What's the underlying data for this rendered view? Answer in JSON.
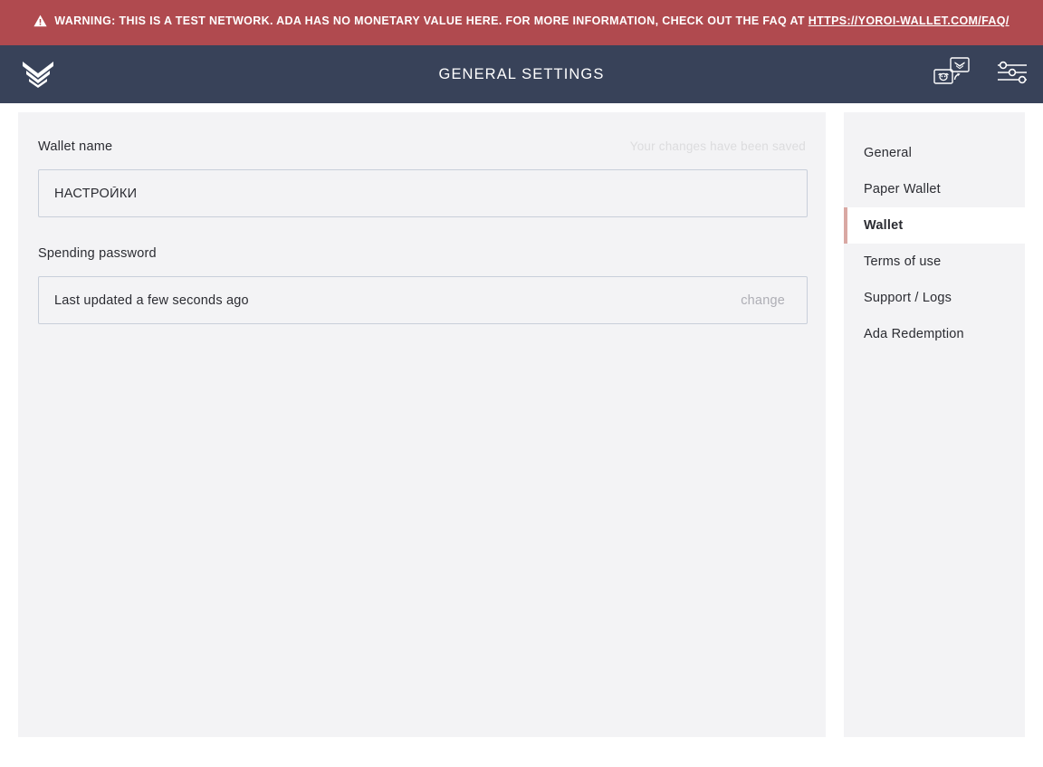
{
  "warning": {
    "icon": "warning-triangle-icon",
    "text_before_link": "WARNING: THIS IS A TEST NETWORK. ADA HAS NO MONETARY VALUE HERE. FOR MORE INFORMATION, CHECK OUT THE FAQ AT ",
    "link_text": "HTTPS://YOROI-WALLET.COM/FAQ/",
    "background_color": "#b04a4f",
    "text_color": "#ffffff"
  },
  "topbar": {
    "logo_name": "yoroi-logo",
    "title": "GENERAL SETTINGS",
    "background_color": "#384259",
    "actions": [
      {
        "name": "wallet-switch-icon",
        "label": "Switch wallet",
        "active": false
      },
      {
        "name": "settings-sliders-icon",
        "label": "Settings",
        "active": true
      }
    ],
    "active_indicator_color": "#d9a8a3"
  },
  "settings": {
    "wallet_name": {
      "label": "Wallet name",
      "value": "НАСТРОЙКИ",
      "placeholder": "Wallet name",
      "saved_message": "Your changes have been saved"
    },
    "spending_password": {
      "label": "Spending password",
      "status": "Last updated a few seconds ago",
      "change_label": "change"
    }
  },
  "menu": {
    "items": [
      {
        "label": "General",
        "active": false
      },
      {
        "label": "Paper Wallet",
        "active": false
      },
      {
        "label": "Wallet",
        "active": true
      },
      {
        "label": "Terms of use",
        "active": false
      },
      {
        "label": "Support / Logs",
        "active": false
      },
      {
        "label": "Ada Redemption",
        "active": false
      }
    ],
    "active_border_color": "#d9a8a3"
  }
}
